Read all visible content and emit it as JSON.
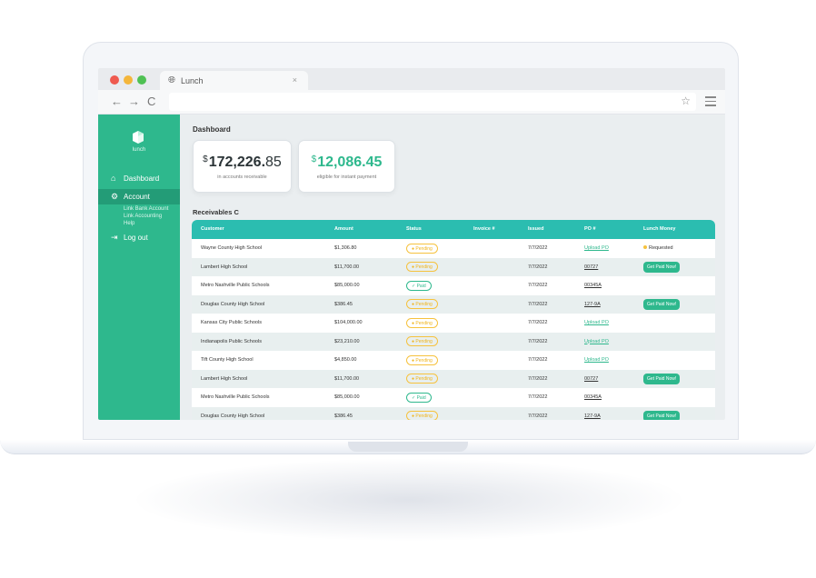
{
  "browser": {
    "tab_title": "Lunch",
    "tab_close": "×",
    "back": "←",
    "forward": "→",
    "reload": "C",
    "url": ""
  },
  "sidebar": {
    "logo_text": "lunch",
    "items": [
      {
        "label": "Dashboard",
        "icon": "home-icon"
      },
      {
        "label": "Account",
        "icon": "gear-icon"
      }
    ],
    "sub_items": [
      "Link Bank Account",
      "Link Accounting",
      "Help"
    ],
    "logout": {
      "label": "Log out",
      "icon": "logout-icon"
    }
  },
  "main": {
    "title": "Dashboard",
    "cards": [
      {
        "currency": "$",
        "whole": "172,226.",
        "decimal": "85",
        "subtitle": "in accounts receivable",
        "color": "#2b3437"
      },
      {
        "currency": "$",
        "whole": "12,086.45",
        "decimal": "",
        "subtitle": "eligible for instant payment",
        "color": "#2eb88d"
      }
    ],
    "receivables_title": "Receivables",
    "refresh_icon": "C"
  },
  "table": {
    "columns": [
      "Customer",
      "Amount",
      "Status",
      "Invoice #",
      "Issued",
      "PO #",
      "Lunch Money"
    ],
    "rows": [
      {
        "customer": "Wayne County High School",
        "amount": "$1,306.80",
        "status": "Pending",
        "invoice": "",
        "issued": "7/7/2022",
        "po": "Upload PO",
        "lunch": "Requested"
      },
      {
        "customer": "Lambert High School",
        "amount": "$11,700.00",
        "status": "Pending",
        "invoice": "",
        "issued": "7/7/2022",
        "po": "00727",
        "lunch": "Get Paid Now!"
      },
      {
        "customer": "Metro Nashville Public Schools",
        "amount": "$85,000.00",
        "status": "Paid",
        "invoice": "",
        "issued": "7/7/2022",
        "po": "00345A",
        "lunch": ""
      },
      {
        "customer": "Douglas County High School",
        "amount": "$386.45",
        "status": "Pending",
        "invoice": "",
        "issued": "7/7/2022",
        "po": "127-9A",
        "lunch": "Get Paid Now!"
      },
      {
        "customer": "Kansas City Public Schools",
        "amount": "$104,000.00",
        "status": "Pending",
        "invoice": "",
        "issued": "7/7/2022",
        "po": "Upload PO",
        "lunch": ""
      },
      {
        "customer": "Indianapolis Public Schools",
        "amount": "$23,210.00",
        "status": "Pending",
        "invoice": "",
        "issued": "7/7/2022",
        "po": "Upload PO",
        "lunch": ""
      },
      {
        "customer": "Tift County High School",
        "amount": "$4,850.00",
        "status": "Pending",
        "invoice": "",
        "issued": "7/7/2022",
        "po": "Upload PO",
        "lunch": ""
      },
      {
        "customer": "Lambert High School",
        "amount": "$11,700.00",
        "status": "Pending",
        "invoice": "",
        "issued": "7/7/2022",
        "po": "00727",
        "lunch": "Get Paid Now!"
      },
      {
        "customer": "Metro Nashville Public Schools",
        "amount": "$85,000.00",
        "status": "Paid",
        "invoice": "",
        "issued": "7/7/2022",
        "po": "00345A",
        "lunch": ""
      },
      {
        "customer": "Douglas County High School",
        "amount": "$386.45",
        "status": "Pending",
        "invoice": "",
        "issued": "7/7/2022",
        "po": "127-9A",
        "lunch": "Get Paid Now!"
      }
    ]
  },
  "colors": {
    "brand": "#2eb88d",
    "header": "#2bbdb0",
    "pending": "#f6c23e"
  }
}
